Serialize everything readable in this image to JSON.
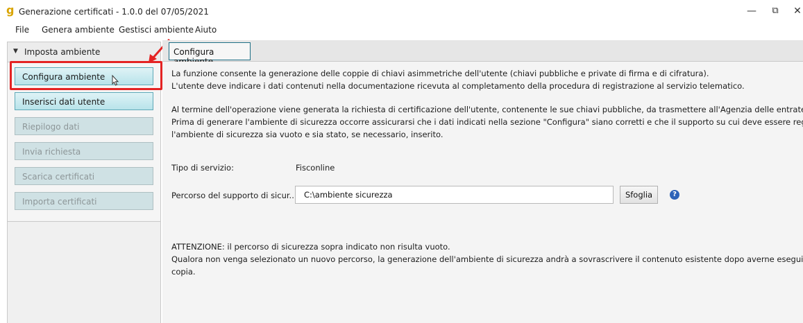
{
  "window": {
    "title": "Generazione certificati - 1.0.0 del 07/05/2021",
    "app_icon_glyph": "g",
    "minimize_glyph": "—",
    "restore_glyph": "⧉",
    "close_glyph": "✕"
  },
  "menu": {
    "items": [
      "File",
      "Genera ambiente",
      "Gestisci ambiente",
      "Aiuto"
    ]
  },
  "sidebar": {
    "section_label": "Imposta ambiente",
    "section_icon": "triangle-down-icon",
    "items": [
      {
        "label": "Configura ambiente",
        "state": "active"
      },
      {
        "label": "Inserisci dati utente",
        "state": "active"
      },
      {
        "label": "Riepilogo dati",
        "state": "disabled"
      },
      {
        "label": "Invia richiesta",
        "state": "disabled"
      },
      {
        "label": "Scarica certificati",
        "state": "disabled"
      },
      {
        "label": "Importa certificati",
        "state": "disabled"
      }
    ]
  },
  "main": {
    "tab_label": "Configura ambiente",
    "paragraph1": [
      "La funzione consente la generazione delle coppie di chiavi asimmetriche dell'utente (chiavi pubbliche e private di firma e di cifratura).",
      "L'utente deve indicare i dati contenuti nella documentazione ricevuta al completamento della procedura di registrazione al servizio telematico."
    ],
    "paragraph2": [
      "Al termine dell'operazione viene generata la richiesta di certificazione dell'utente, contenente le sue chiavi pubbliche, da trasmettere all'Agenzia delle entrate.",
      "Prima di generare l'ambiente di sicurezza occorre assicurarsi che i dati indicati nella sezione \"Configura\" siano corretti e che il supporto su cui deve essere registrato",
      "l'ambiente di sicurezza sia vuoto e sia stato, se necessario, inserito."
    ],
    "service_type_label": "Tipo di servizio:",
    "service_type_value": "Fisconline",
    "path_label": "Percorso del supporto di sicur...",
    "path_value": "C:\\ambiente sicurezza",
    "browse_label": "Sfoglia",
    "help_glyph": "?",
    "warning": [
      "ATTENZIONE: il percorso di sicurezza sopra indicato non risulta vuoto.",
      "Qualora non venga selezionato un nuovo percorso, la generazione dell'ambiente di sicurezza andrà a sovrascrivere il contenuto esistente dopo averne eseguio una",
      "copia."
    ]
  },
  "colors": {
    "highlight": "#e42323",
    "active_button": "#b8e3ea",
    "disabled_button": "#cfe1e4"
  }
}
